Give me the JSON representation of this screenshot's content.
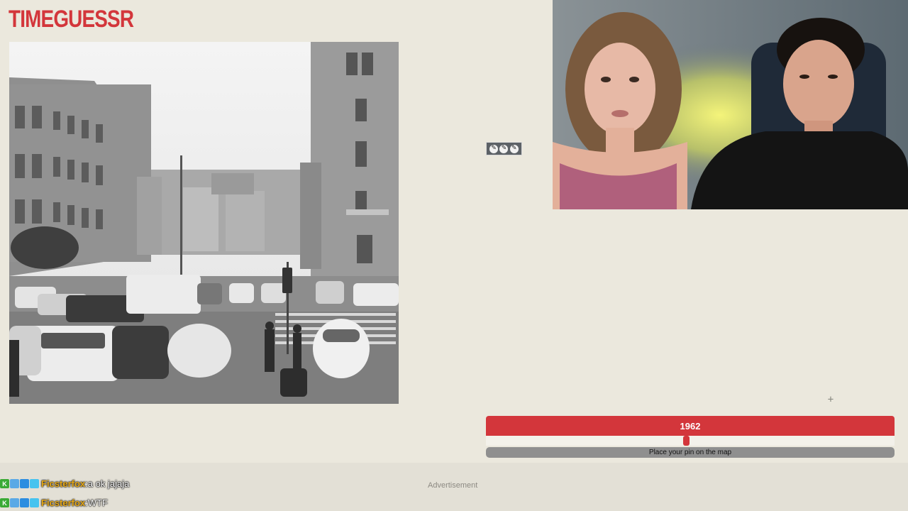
{
  "brand": {
    "logo_text": "TIMEGUESSR"
  },
  "game": {
    "year_display": "1962",
    "year_slider_fraction": 0.49,
    "pin_prompt": "Place your pin on the map"
  },
  "map_controls": [
    {
      "icon": "tool-icon"
    },
    {
      "icon": "tool-icon"
    },
    {
      "icon": "tool-icon"
    }
  ],
  "advertisement": {
    "label": "Advertisement"
  },
  "chat": {
    "messages": [
      {
        "user": "Ficsterfox",
        "separator": " : ",
        "text": "a ok jajaja"
      },
      {
        "user": "Ficsterfox",
        "separator": " : ",
        "text": "WTF"
      }
    ],
    "badge_colors": [
      "#3aaa35",
      "#5aa9e6",
      "#2b8de0",
      "#46c3ef"
    ]
  },
  "colors": {
    "accent": "#d3363b",
    "background": "#ebe8dd",
    "chat_username": "#e6a817"
  }
}
